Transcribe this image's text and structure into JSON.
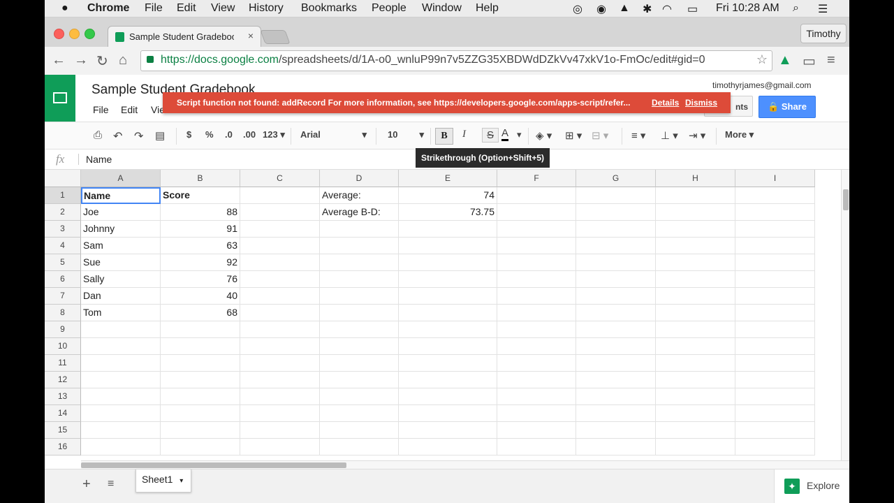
{
  "macos": {
    "apple": "",
    "app": "Chrome",
    "menus": [
      "File",
      "Edit",
      "View",
      "History",
      "Bookmarks",
      "People",
      "Window",
      "Help"
    ],
    "clock": "Fri 10:28 AM"
  },
  "browser": {
    "tab_title": "Sample Student Gradebook",
    "tab_close": "×",
    "profile": "Timothy",
    "url_host": "https://docs.google.com",
    "url_path": "/spreadsheets/d/1A-o0_wnluP99n7v5ZZG35XBDWdDZkVv47xkV1o-FmOc/edit#gid=0"
  },
  "app": {
    "title": "Sample Student Gradebook",
    "menus": [
      "File",
      "Edit",
      "Vie"
    ],
    "email": "timothyrjames@gmail.com",
    "comments_label": "nts",
    "share_label": "Share"
  },
  "error": {
    "message": "Script function not found: addRecord For more information, see https://developers.google.com/apps-script/refer...",
    "details": "Details",
    "dismiss": "Dismiss"
  },
  "format_toolbar": {
    "currency": "$",
    "percent": "%",
    "dec_decrease": ".0",
    "dec_increase": ".00",
    "number_format": "123",
    "font": "Arial",
    "font_size": "10",
    "bold": "B",
    "italic": "I",
    "strikethrough": "S",
    "text_color": "A",
    "more": "More",
    "tooltip": "Strikethrough (Option+Shift+5)"
  },
  "formula_bar": {
    "fx": "fx",
    "value": "Name"
  },
  "sheet": {
    "columns": [
      "A",
      "B",
      "C",
      "D",
      "E",
      "F",
      "G",
      "H",
      "I"
    ],
    "rows": [
      "1",
      "2",
      "3",
      "4",
      "5",
      "6",
      "7",
      "8",
      "9",
      "10",
      "11",
      "12",
      "13",
      "14",
      "15",
      "16"
    ],
    "cells": {
      "A": [
        "Name",
        "Joe",
        "Johnny",
        "Sam",
        "Sue",
        "Sally",
        "Dan",
        "Tom"
      ],
      "B": [
        "Score",
        "88",
        "91",
        "63",
        "92",
        "76",
        "40",
        "68"
      ],
      "D": [
        "Average:",
        "Average B-D:"
      ],
      "E": [
        "74",
        "73.75"
      ]
    }
  },
  "bottom": {
    "add": "+",
    "list": "≡",
    "sheet_tab": "Sheet1",
    "explore": "Explore"
  },
  "colors": {
    "sheets_green": "#0f9d58",
    "error_red": "#dd4b39",
    "share_blue": "#4d90fe",
    "selection_blue": "#4285f4"
  }
}
